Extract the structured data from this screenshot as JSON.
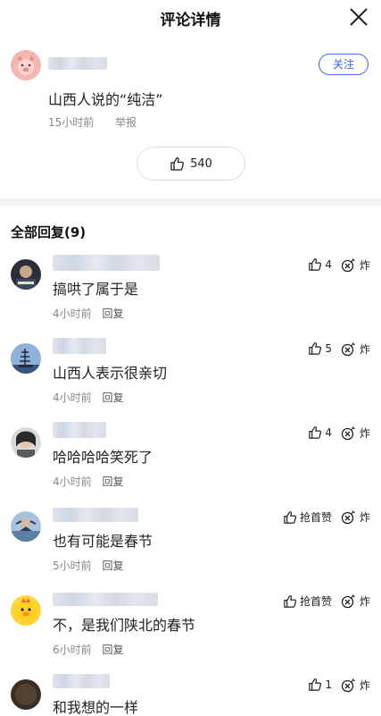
{
  "header": {
    "title": "评论详情",
    "close_icon": "close-icon"
  },
  "main_comment": {
    "follow_label": "关注",
    "text": "山西人说的“纯洁”",
    "time": "15小时前",
    "report_label": "举报",
    "like_count": "540"
  },
  "replies_header": "全部回复(9)",
  "replies": [
    {
      "text": "搞哄了属于是",
      "time": "4小时前",
      "reply_label": "回复",
      "like": "4",
      "boom": "炸"
    },
    {
      "text": "山西人表示很亲切",
      "time": "4小时前",
      "reply_label": "回复",
      "like": "5",
      "boom": "炸"
    },
    {
      "text": "哈哈哈哈笑死了",
      "time": "4小时前",
      "reply_label": "回复",
      "like": "4",
      "boom": "炸"
    },
    {
      "text": "也有可能是春节",
      "time": "5小时前",
      "reply_label": "回复",
      "like": "抢首赞",
      "boom": "炸"
    },
    {
      "text": "不，是我们陕北的春节",
      "time": "6小时前",
      "reply_label": "回复",
      "like": "抢首赞",
      "boom": "炸"
    },
    {
      "text": "和我想的一样",
      "time": "",
      "reply_label": "",
      "like": "1",
      "boom": "炸"
    }
  ]
}
